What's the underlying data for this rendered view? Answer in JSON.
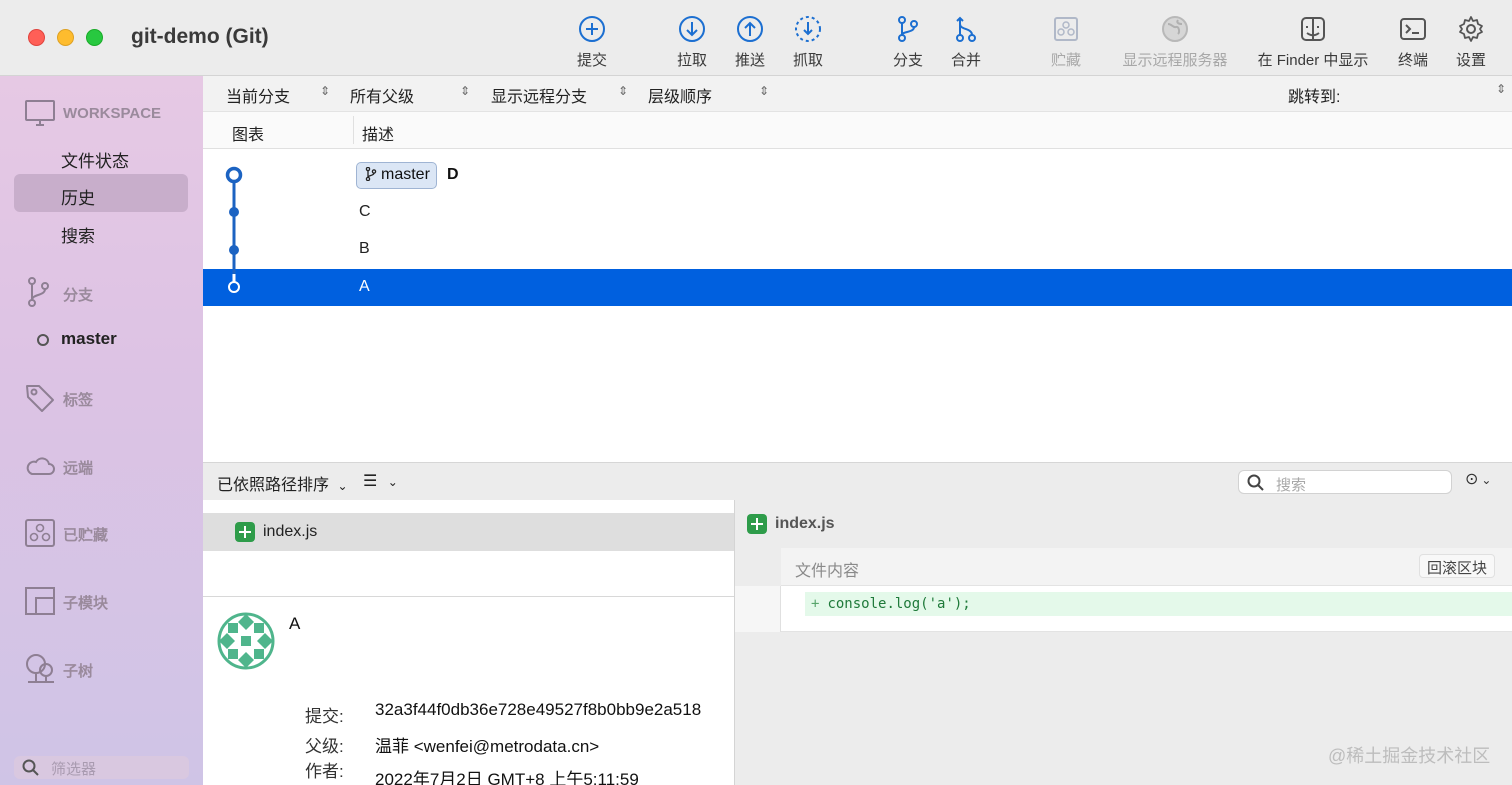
{
  "window": {
    "title": "git-demo (Git)"
  },
  "toolbar": {
    "commit": "提交",
    "pull": "拉取",
    "push": "推送",
    "fetch": "抓取",
    "branch": "分支",
    "merge": "合并",
    "stash": "贮藏",
    "show_remote": "显示远程服务器",
    "show_in_finder": "在 Finder 中显示",
    "terminal": "终端",
    "settings": "设置"
  },
  "sidebar": {
    "workspace": "WORKSPACE",
    "file_status": "文件状态",
    "history": "历史",
    "search": "搜索",
    "branches": "分支",
    "current_branch": "master",
    "tags": "标签",
    "remotes": "远端",
    "stashes": "已贮藏",
    "submodules": "子模块",
    "subtrees": "子树",
    "filter_placeholder": "筛选器"
  },
  "history_filters": {
    "branch_scope": "当前分支",
    "parents": "所有父级",
    "remote_branches": "显示远程分支",
    "order": "层级顺序",
    "jump_to": "跳转到:"
  },
  "columns": {
    "graph": "图表",
    "description": "描述"
  },
  "commits": [
    {
      "message": "D",
      "branch_tag": "master"
    },
    {
      "message": "C"
    },
    {
      "message": "B"
    },
    {
      "message": "A"
    }
  ],
  "selected_commit_index": 3,
  "file_toolbar": {
    "sort": "已依照路径排序",
    "search_placeholder": "搜索"
  },
  "files": [
    {
      "name": "index.js",
      "status": "added"
    }
  ],
  "commit_details": {
    "title": "A",
    "commit_label": "提交:",
    "commit_hash": "32a3f44f0db36e728e49527f8b0bb9e2a518",
    "parents_label": "父级:",
    "parents_value": "温菲 <wenfei@metrodata.cn>",
    "author_label": "作者:",
    "date_value": "2022年7月2日 GMT+8 上午5:11:59"
  },
  "diff": {
    "file_name": "index.js",
    "hunk_title": "文件内容",
    "hunk_button": "回滚区块",
    "lines": [
      {
        "sign": "+",
        "code": "console.log('a');"
      }
    ]
  },
  "watermark": "@稀土掘金技术社区",
  "colors": {
    "accent": "#0060df",
    "graph_line": "#1c63c2",
    "added": "#2e9c4a"
  }
}
